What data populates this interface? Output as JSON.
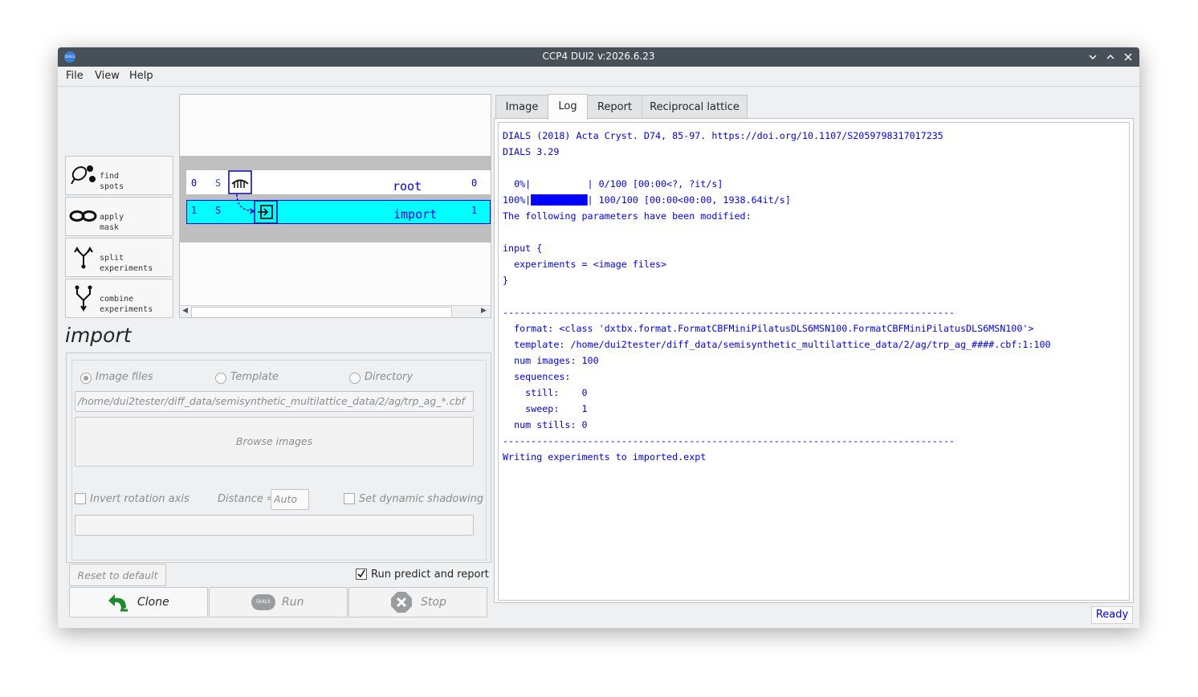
{
  "window": {
    "title": "CCP4 DUI2 v:2026.6.23",
    "icon_text": "DIALS"
  },
  "menu": {
    "file": "File",
    "view": "View",
    "help": "Help"
  },
  "tools": [
    {
      "l1": "find",
      "l2": "spots"
    },
    {
      "l1": "apply",
      "l2": "mask"
    },
    {
      "l1": "split",
      "l2": "experiments"
    },
    {
      "l1": "combine",
      "l2": "experiments"
    }
  ],
  "tree": {
    "nodes": [
      {
        "num": "0",
        "state": "S",
        "name": "root",
        "count": "0"
      },
      {
        "num": "1",
        "state": "S",
        "name": "import",
        "count": "1"
      }
    ],
    "selected_color": "#00ffff"
  },
  "panel": {
    "heading": "import",
    "radio_image_files": "Image files",
    "radio_template": "Template",
    "radio_directory": "Directory",
    "path_value": "/home/dui2tester/diff_data/semisynthetic_multilattice_data/2/ag/trp_ag_*.cbf",
    "browse_label": "Browse images",
    "invert_label": "Invert rotation axis",
    "distance_label": "Distance =",
    "distance_placeholder": "Auto",
    "shadowing_label": "Set dynamic shadowing",
    "reset_label": "Reset to default",
    "run_predict_label": "Run predict and report",
    "clone_label": "Clone",
    "run_label": "Run",
    "run_icon_text": "DIALS",
    "stop_label": "Stop"
  },
  "tabs": [
    "Image",
    "Log",
    "Report",
    "Reciprocal lattice"
  ],
  "log": {
    "lines": [
      "DIALS (2018) Acta Cryst. D74, 85-97. https://doi.org/10.1107/S2059798317017235",
      "DIALS 3.29",
      "",
      "  0%|          | 0/100 [00:00<?, ?it/s]",
      "100%|██████████| 100/100 [00:00<00:00, 1938.64it/s]",
      "The following parameters have been modified:",
      "",
      "input {",
      "  experiments = <image files>",
      "}",
      "",
      "--------------------------------------------------------------------------------",
      "  format: <class 'dxtbx.format.FormatCBFMiniPilatusDLS6MSN100.FormatCBFMiniPilatusDLS6MSN100'>",
      "  template: /home/dui2tester/diff_data/semisynthetic_multilattice_data/2/ag/trp_ag_####.cbf:1:100",
      "  num images: 100",
      "  sequences:",
      "    still:    0",
      "    sweep:    1",
      "  num stills: 0",
      "--------------------------------------------------------------------------------",
      "Writing experiments to imported.expt"
    ],
    "color": "#0000ff"
  },
  "status": "Ready"
}
